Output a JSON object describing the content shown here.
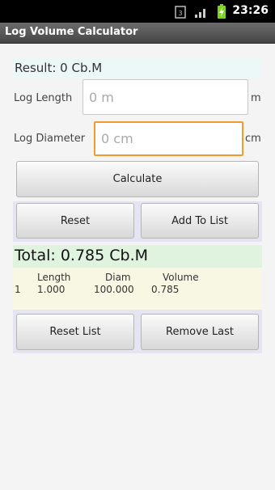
{
  "status_bar": {
    "time": "23:26"
  },
  "title_bar": {
    "title": "Log Volume Calculator"
  },
  "result": {
    "text": "Result: 0 Cb.M"
  },
  "length": {
    "label": "Log Length",
    "placeholder": "0 m",
    "value": "",
    "unit": "m"
  },
  "diameter": {
    "label": "Log Diameter",
    "placeholder": "0 cm",
    "value": "",
    "unit": "cm"
  },
  "buttons": {
    "calculate": "Calculate",
    "reset": "Reset",
    "add_to_list": "Add To List",
    "reset_list": "Reset List",
    "remove_last": "Remove Last"
  },
  "total": {
    "text": "Total: 0.785 Cb.M"
  },
  "list": {
    "headers": [
      "Length",
      "Diam",
      "Volume"
    ],
    "rows": [
      {
        "index": "1",
        "length": "1.000",
        "diam": "100.000",
        "volume": "0.785"
      }
    ]
  }
}
